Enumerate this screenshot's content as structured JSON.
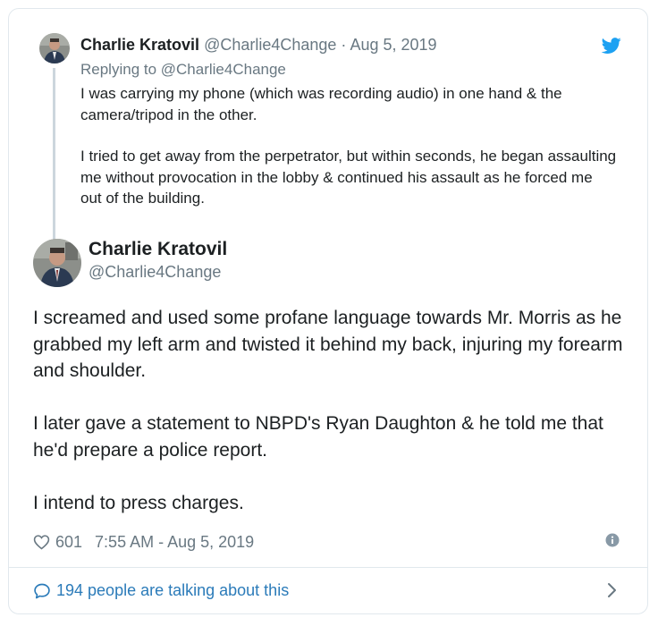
{
  "reply_tweet": {
    "author_name": "Charlie Kratovil",
    "author_handle": "@Charlie4Change",
    "separator": " · ",
    "date": "Aug 5, 2019",
    "replying_to": "Replying to @Charlie4Change",
    "paragraphs": [
      "I was carrying my phone (which was recording audio) in one hand & the camera/tripod in the other.",
      "I tried to get away from the perpetrator, but within seconds, he began assaulting me without provocation in the lobby & continued his assault as he forced me out of the building."
    ]
  },
  "main_tweet": {
    "author_name": "Charlie Kratovil",
    "author_handle": "@Charlie4Change",
    "paragraphs": [
      "I screamed and used some profane language towards Mr. Morris as he grabbed my left arm and twisted it behind my back, injuring my forearm and shoulder.",
      "I later gave a statement to NBPD's Ryan Daughton & he told me that he'd prepare a police report.",
      "I intend to press charges."
    ],
    "likes": "601",
    "timestamp": "7:55 AM - Aug 5, 2019"
  },
  "footer": {
    "talking_text": "194 people are talking about this"
  },
  "colors": {
    "twitter_blue": "#1da1f2",
    "link_blue": "#2b7bb9",
    "secondary_text": "#697882",
    "border": "#e1e8ed"
  },
  "icons": {
    "brand": "twitter-bird-icon",
    "like": "heart-icon",
    "info": "info-icon",
    "conversation": "speech-bubble-icon",
    "navigate": "chevron-right-icon"
  }
}
